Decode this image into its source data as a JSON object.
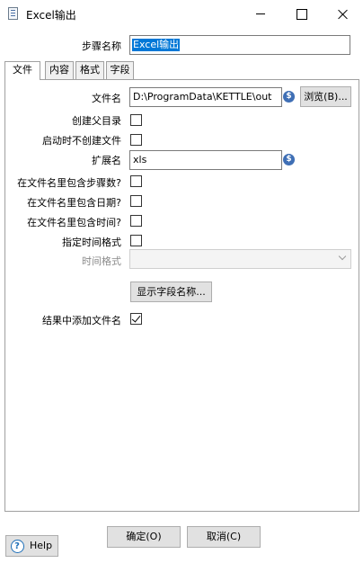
{
  "window": {
    "title": "Excel输出",
    "minimize_icon": "minimize-icon",
    "maximize_icon": "maximize-icon",
    "close_icon": "close-icon"
  },
  "step": {
    "label": "步骤名称",
    "value": "Excel输出"
  },
  "tabs": [
    {
      "label": "文件",
      "active": true
    },
    {
      "label": "内容",
      "active": false
    },
    {
      "label": "格式",
      "active": false
    },
    {
      "label": "字段",
      "active": false
    }
  ],
  "file_tab": {
    "filename": {
      "label": "文件名",
      "value": "D:\\ProgramData\\KETTLE\\out",
      "browse_label": "浏览(B)..."
    },
    "create_parent_dir": {
      "label": "创建父目录",
      "checked": false
    },
    "no_create_on_start": {
      "label": "启动时不创建文件",
      "checked": false
    },
    "extension": {
      "label": "扩展名",
      "value": "xls"
    },
    "include_stepnr": {
      "label": "在文件名里包含步骤数?",
      "checked": false
    },
    "include_date": {
      "label": "在文件名里包含日期?",
      "checked": false
    },
    "include_time": {
      "label": "在文件名里包含时间?",
      "checked": false
    },
    "specify_time_format": {
      "label": "指定时间格式",
      "checked": false
    },
    "time_format": {
      "label": "时间格式",
      "value": ""
    },
    "show_fields_label": "显示字段名称...",
    "add_to_result": {
      "label": "结果中添加文件名",
      "checked": true
    }
  },
  "footer": {
    "ok_label": "确定(O)",
    "cancel_label": "取消(C)",
    "help_label": "Help"
  },
  "colors": {
    "selection": "#0078d7",
    "variable_icon": "#3f6fb5",
    "help_icon": "#1e6fb8"
  }
}
